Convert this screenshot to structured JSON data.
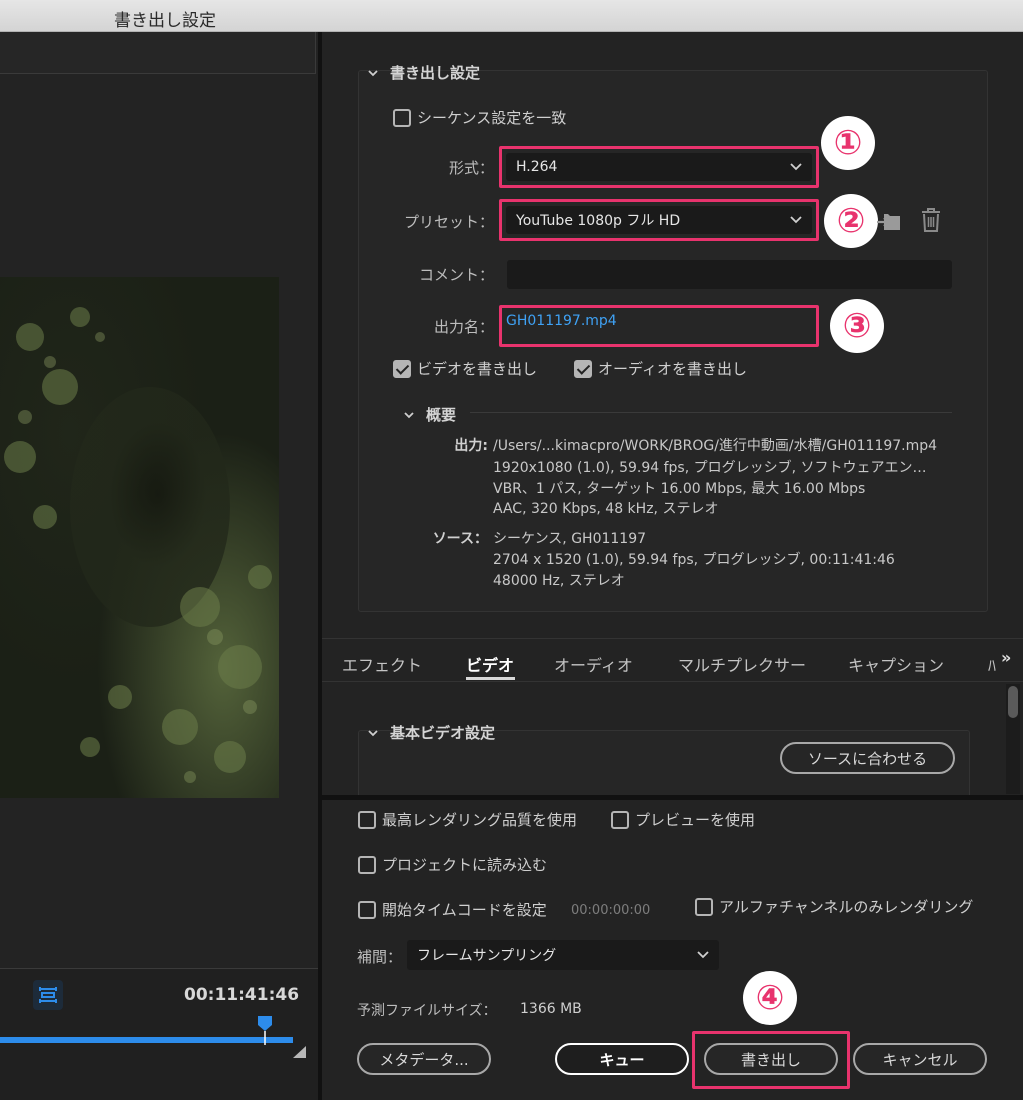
{
  "window": {
    "title": "書き出し設定"
  },
  "timeline": {
    "timecode": "00:11:41:46"
  },
  "export_settings": {
    "section_title": "書き出し設定",
    "match_sequence_label": "シーケンス設定を一致",
    "format_label": "形式：",
    "format_value": "H.264",
    "preset_label": "プリセット：",
    "preset_value": "YouTube 1080p フル HD",
    "comment_label": "コメント：",
    "comment_value": "",
    "output_name_label": "出力名：",
    "output_name_value": "GH011197.mp4",
    "export_video_label": "ビデオを書き出し",
    "export_audio_label": "オーディオを書き出し"
  },
  "badges": {
    "b1": "①",
    "b2": "②",
    "b3": "③",
    "b4": "④"
  },
  "summary": {
    "title": "概要",
    "output_key": "出力:",
    "output_lines": [
      "/Users/...kimacpro/WORK/BROG/進行中動画/水槽/GH011197.mp4",
      "1920x1080 (1.0), 59.94 fps, プログレッシブ, ソフトウェアエン…",
      "VBR、1 パス, ターゲット 16.00 Mbps, 最大 16.00 Mbps",
      "AAC, 320 Kbps, 48 kHz, ステレオ"
    ],
    "source_key": "ソース：",
    "source_lines": [
      "シーケンス, GH011197",
      "2704 x 1520 (1.0), 59.94 fps, プログレッシブ, 00:11:41:46",
      "48000 Hz, ステレオ"
    ]
  },
  "tabs": [
    "エフェクト",
    "ビデオ",
    "オーディオ",
    "マルチプレクサー",
    "キャプション",
    "ﾊ"
  ],
  "tab_overflow": "»",
  "basic_video": {
    "title": "基本ビデオ設定",
    "match_source_button": "ソースに合わせる"
  },
  "options": {
    "max_render_quality": "最高レンダリング品質を使用",
    "use_previews": "プレビューを使用",
    "import_into_project": "プロジェクトに読み込む",
    "set_start_timecode": "開始タイムコードを設定",
    "start_timecode_value": "00:00:00:00",
    "render_alpha_only": "アルファチャンネルのみレンダリング",
    "interpolation_label": "補間：",
    "interpolation_value": "フレームサンプリング",
    "estimated_size_label": "予測ファイルサイズ：",
    "estimated_size_value": "1366 MB"
  },
  "buttons": {
    "metadata": "メタデータ...",
    "queue": "キュー",
    "export": "書き出し",
    "cancel": "キャンセル"
  },
  "colors": {
    "highlight": "#e8336d",
    "accent_blue": "#2d8ceb",
    "link_blue": "#3fa2f5"
  }
}
